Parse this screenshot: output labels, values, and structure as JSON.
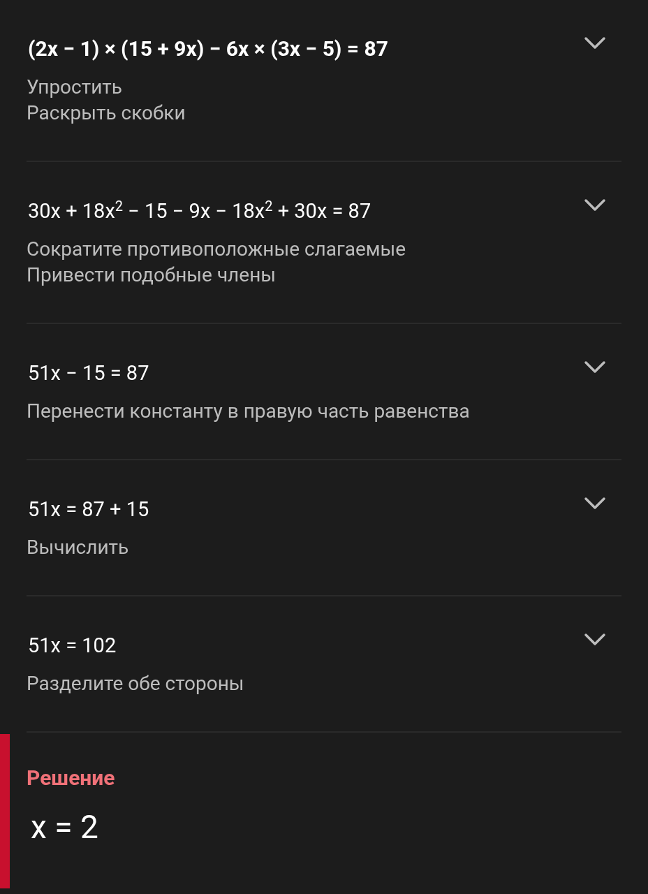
{
  "steps": [
    {
      "equation": "(2x − 1) × (15 + 9x) − 6x × (3x − 5) = 87",
      "bold": true,
      "expanded": false,
      "hints": [
        "Упростить",
        "Раскрыть скобки"
      ]
    },
    {
      "equation": "30x + 18x$^{2}$ − 15 − 9x − 18x$^{2}$ + 30x = 87",
      "bold": false,
      "expanded": false,
      "hints": [
        "Сократите противоположные слагаемые",
        "Привести подобные члены"
      ]
    },
    {
      "equation": "51x − 15 = 87",
      "bold": false,
      "expanded": false,
      "hints": [
        "Перенести константу в правую часть равенства"
      ]
    },
    {
      "equation": "51x = 87 + 15",
      "bold": false,
      "expanded": false,
      "hints": [
        "Вычислить"
      ]
    },
    {
      "equation": "51x = 102",
      "bold": false,
      "expanded": false,
      "hints": [
        "Разделите обе стороны"
      ]
    }
  ],
  "solution": {
    "title": "Решение",
    "answer": "x = 2"
  }
}
